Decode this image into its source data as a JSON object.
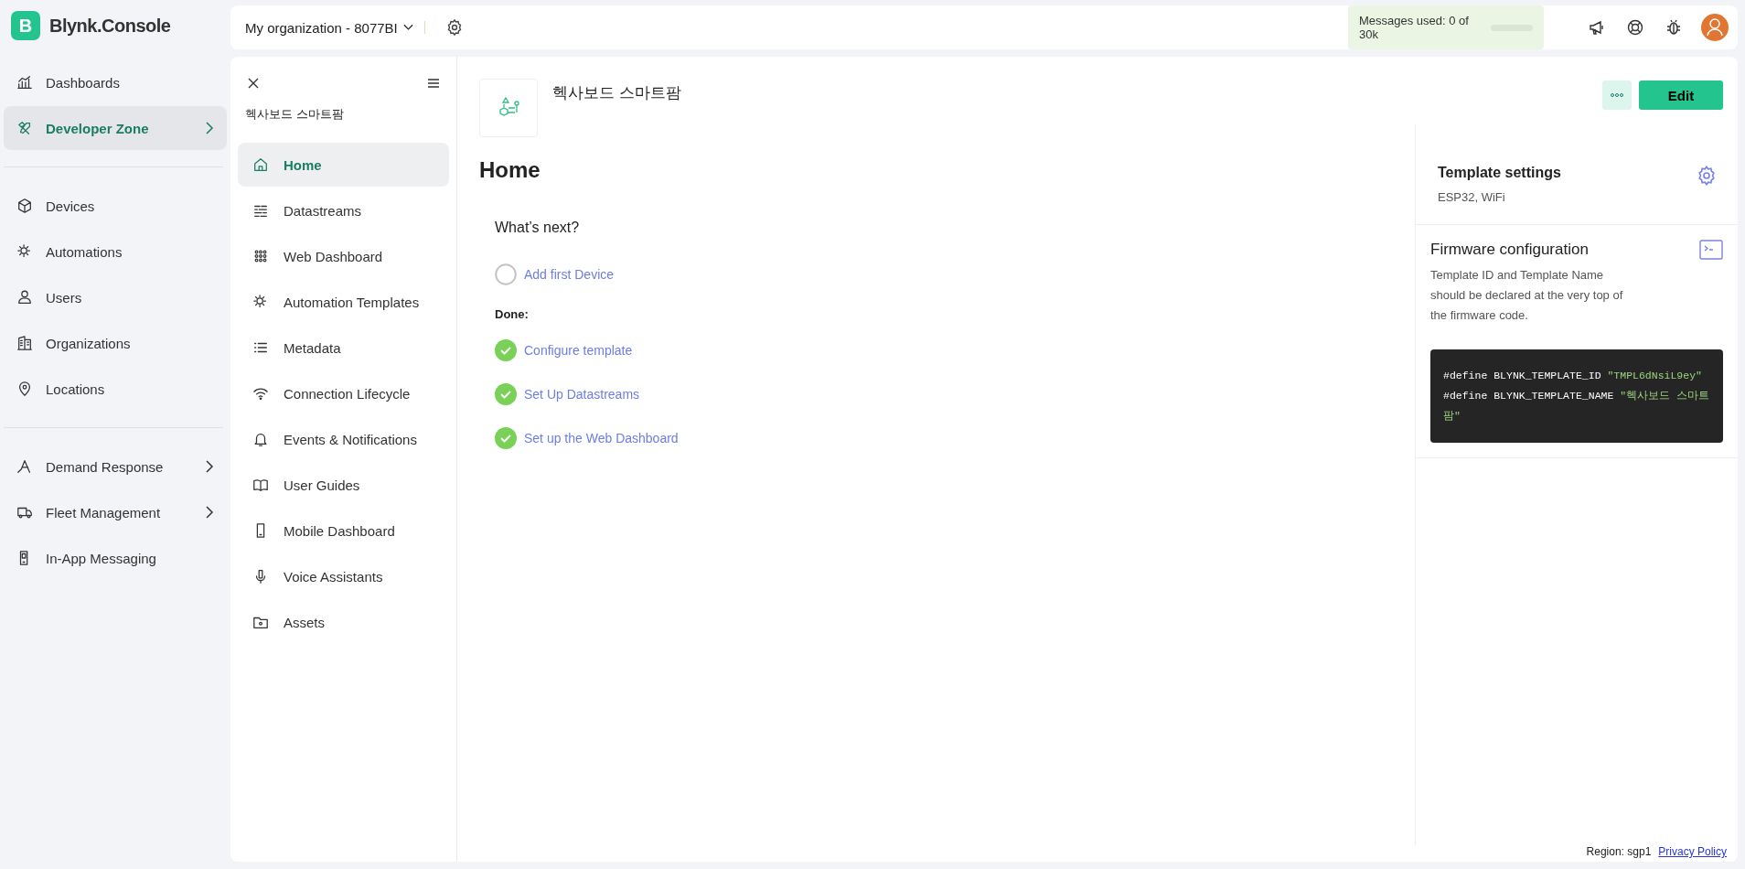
{
  "sidebar": {
    "logo_letter": "B",
    "brand": "Blynk.Console",
    "groups": [
      {
        "items": [
          {
            "label": "Dashboards",
            "selected": false,
            "submenu": false
          },
          {
            "label": "Developer Zone",
            "selected": true,
            "submenu": true
          }
        ]
      },
      {
        "items": [
          {
            "label": "Devices",
            "selected": false,
            "submenu": false
          },
          {
            "label": "Automations",
            "selected": false,
            "submenu": false
          },
          {
            "label": "Users",
            "selected": false,
            "submenu": false
          },
          {
            "label": "Organizations",
            "selected": false,
            "submenu": false
          },
          {
            "label": "Locations",
            "selected": false,
            "submenu": false
          }
        ]
      },
      {
        "items": [
          {
            "label": "Demand Response",
            "selected": false,
            "submenu": true
          },
          {
            "label": "Fleet Management",
            "selected": false,
            "submenu": true
          },
          {
            "label": "In-App Messaging",
            "selected": false,
            "submenu": false
          }
        ]
      }
    ]
  },
  "header": {
    "organization": "My organization - 8077BI",
    "messages": {
      "label": "Messages used: 0 of 30k",
      "level": 0
    }
  },
  "template_nav": {
    "title": "헥사보드 스마트팜",
    "items": [
      {
        "label": "Home",
        "selected": true
      },
      {
        "label": "Datastreams",
        "selected": false
      },
      {
        "label": "Web Dashboard",
        "selected": false
      },
      {
        "label": "Automation Templates",
        "selected": false
      },
      {
        "label": "Metadata",
        "selected": false
      },
      {
        "label": "Connection Lifecycle",
        "selected": false
      },
      {
        "label": "Events & Notifications",
        "selected": false
      },
      {
        "label": "User Guides",
        "selected": false
      },
      {
        "label": "Mobile Dashboard",
        "selected": false
      },
      {
        "label": "Voice Assistants",
        "selected": false
      },
      {
        "label": "Assets",
        "selected": false
      }
    ]
  },
  "template": {
    "name": "헥사보드 스마트팜",
    "edit_button": "Edit",
    "page_title": "Home"
  },
  "next_steps": {
    "title": "What’s next?",
    "todo": [
      {
        "label": "Add first Device",
        "done": false
      }
    ],
    "done_label": "Done:",
    "done": [
      {
        "label": "Configure template",
        "done": true
      },
      {
        "label": "Set Up Datastreams",
        "done": true
      },
      {
        "label": "Set up the Web Dashboard",
        "done": true
      }
    ]
  },
  "template_settings": {
    "title": "Template settings",
    "subtitle": "ESP32, WiFi"
  },
  "firmware": {
    "title": "Firmware configuration",
    "description": "Template ID and Template Name should be declared at the very top of the firmware code.",
    "code": [
      [
        {
          "kind": "plain",
          "text": "#define BLYNK_TEMPLATE_ID "
        },
        {
          "kind": "string",
          "text": "\"TMPL6dNsiL9ey\""
        }
      ],
      [
        {
          "kind": "plain",
          "text": "#define BLYNK_TEMPLATE_NAME "
        },
        {
          "kind": "string",
          "text": "\"헥사보드 스마트팜\""
        }
      ]
    ]
  },
  "footer": {
    "region": "Region: sgp1",
    "privacy_link": "Privacy Policy"
  }
}
